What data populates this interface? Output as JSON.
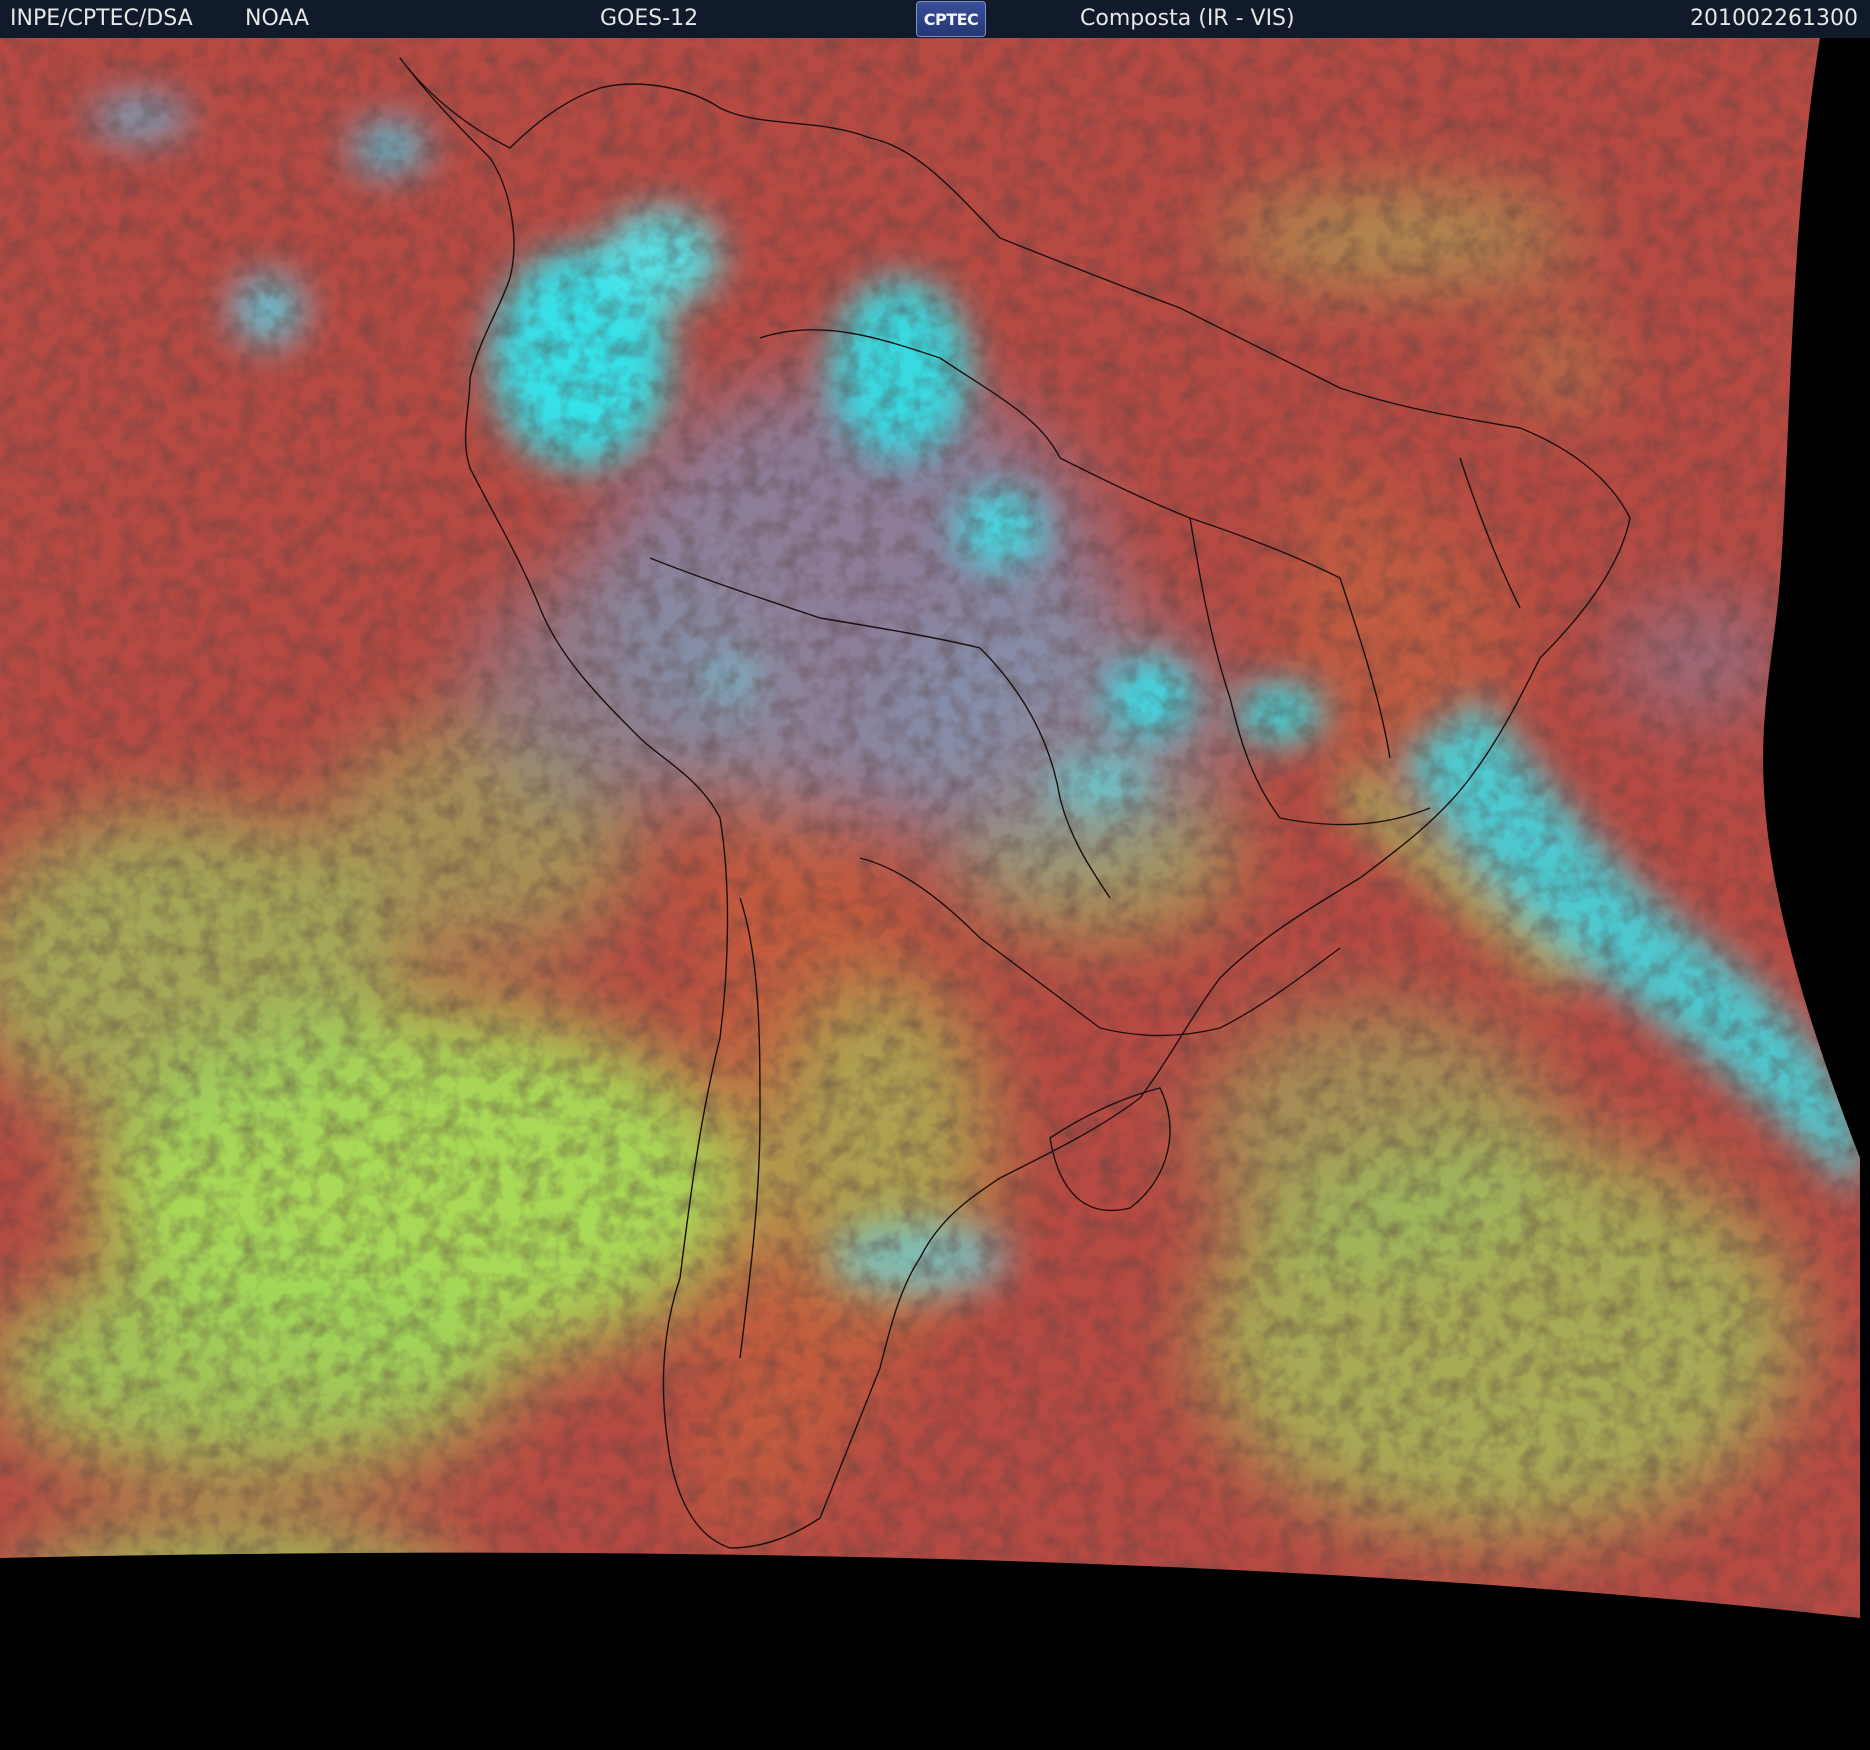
{
  "header": {
    "agency": "INPE/CPTEC/DSA",
    "source": "NOAA",
    "satellite": "GOES-12",
    "logo_text": "CPTEC",
    "product": "Composta (IR - VIS)",
    "timestamp": "201002261300"
  },
  "colors": {
    "ocean_clear": "#b64a43",
    "land_clear": "#c45a3c",
    "low_cloud": "#a8e05a",
    "high_cloud": "#2ee8f0",
    "mid_cloud": "#7f8fb6",
    "no_data": "#000000",
    "header_bg": "#111a2b"
  },
  "map": {
    "type": "satellite-composite",
    "coverage": "South America",
    "borders": "country-and-state-outlines"
  }
}
